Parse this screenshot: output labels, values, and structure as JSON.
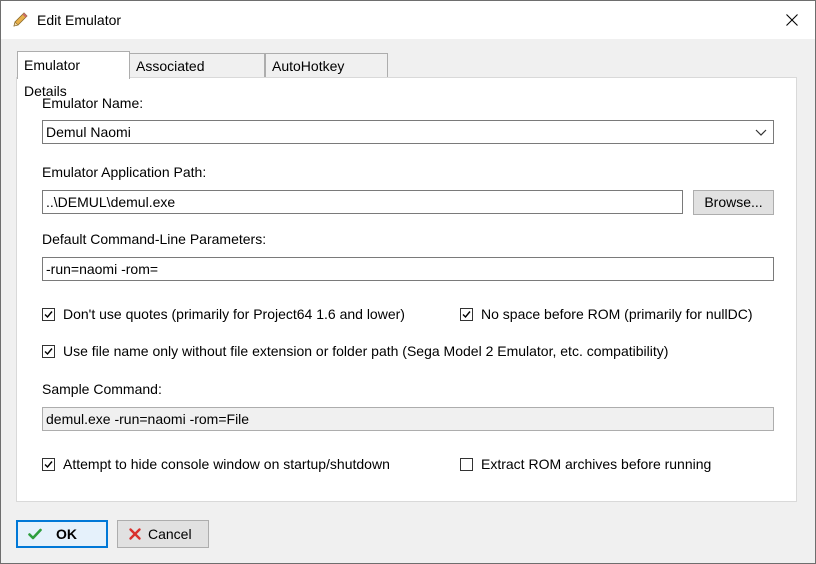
{
  "window": {
    "title": "Edit Emulator"
  },
  "tabs": [
    {
      "label": "Emulator Details"
    },
    {
      "label": "Associated Platforms"
    },
    {
      "label": "AutoHotkey Script"
    }
  ],
  "form": {
    "name_label": "Emulator Name:",
    "name_value": "Demul Naomi",
    "path_label": "Emulator Application Path:",
    "path_value": "..\\DEMUL\\demul.exe",
    "browse_label": "Browse...",
    "params_label": "Default Command-Line Parameters:",
    "params_value": "-run=naomi -rom=",
    "opt_no_quotes": "Don't use quotes (primarily for Project64 1.6 and lower)",
    "opt_no_space": "No space before ROM (primarily for nullDC)",
    "opt_filename_only": "Use file name only without file extension or folder path (Sega Model 2 Emulator, etc. compatibility)",
    "sample_label": "Sample Command:",
    "sample_value": "demul.exe -run=naomi -rom=File",
    "opt_hide_console": "Attempt to hide console window on startup/shutdown",
    "opt_extract_rom": "Extract ROM archives before running"
  },
  "checks": {
    "no_quotes": true,
    "no_space": true,
    "filename_only": true,
    "hide_console": true,
    "extract_rom": false
  },
  "buttons": {
    "ok": "OK",
    "cancel": "Cancel"
  },
  "colors": {
    "accent": "#0078d7",
    "ok_icon": "#2e9e3e",
    "cancel_icon": "#d9302c"
  }
}
